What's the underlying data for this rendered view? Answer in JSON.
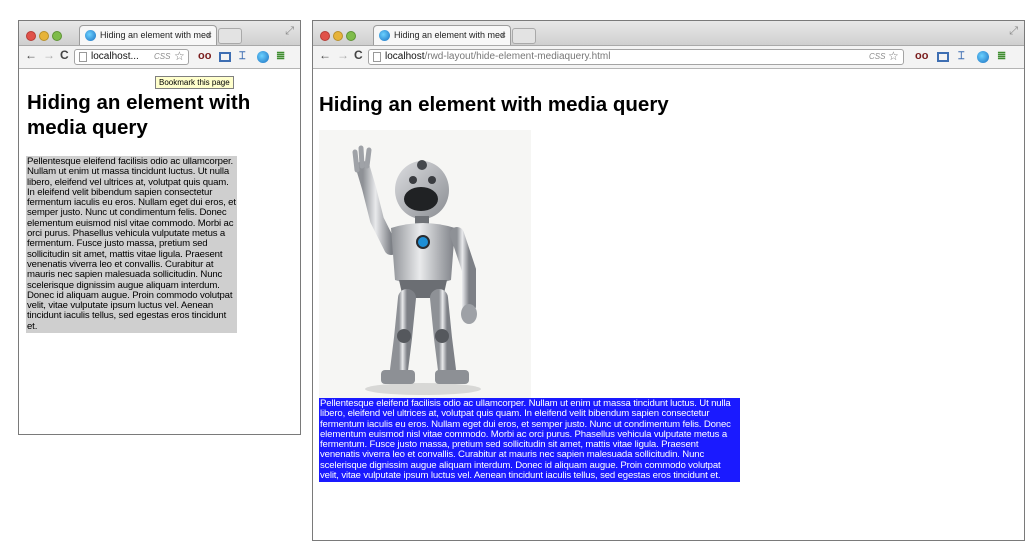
{
  "windows": {
    "small": {
      "tab_title": "Hiding an element with med",
      "tab_close": "×",
      "url_host": "localhost...",
      "css_indicator": "CSS",
      "tooltip": "Bookmark this page"
    },
    "large": {
      "tab_title": "Hiding an element with med",
      "tab_close": "×",
      "url_host": "localhost",
      "url_path": "/rwd-layout/hide-element-mediaquery.html",
      "css_indicator": "CSS"
    }
  },
  "page": {
    "title": "Hiding an element with media query",
    "paragraph": "Pellentesque eleifend facilisis odio ac ullamcorper. Nullam ut enim ut massa tincidunt luctus. Ut nulla libero, eleifend vel ultrices at, volutpat quis quam. In eleifend velit bibendum sapien consectetur fermentum iaculis eu eros. Nullam eget dui eros, et semper justo. Nunc ut condimentum felis. Donec elementum euismod nisl vitae commodo. Morbi ac orci purus. Phasellus vehicula vulputate metus a fermentum. Fusce justo massa, pretium sed sollicitudin sit amet, mattis vitae ligula. Praesent venenatis viverra leo et convallis. Curabitur at mauris nec sapien malesuada sollicitudin. Nunc scelerisque dignissim augue aliquam interdum. Donec id aliquam augue. Proin commodo volutpat velit, vitae vulputate ipsum luctus vel. Aenean tincidunt iaculis tellus, sed egestas eros tincidunt et."
  },
  "nav": {
    "back": "←",
    "forward": "→",
    "reload": "C",
    "star": "☆"
  },
  "colors": {
    "small_paragraph_bg": "#cfcfcf",
    "large_paragraph_bg": "#1a1aff",
    "large_paragraph_text": "#ffffff"
  }
}
